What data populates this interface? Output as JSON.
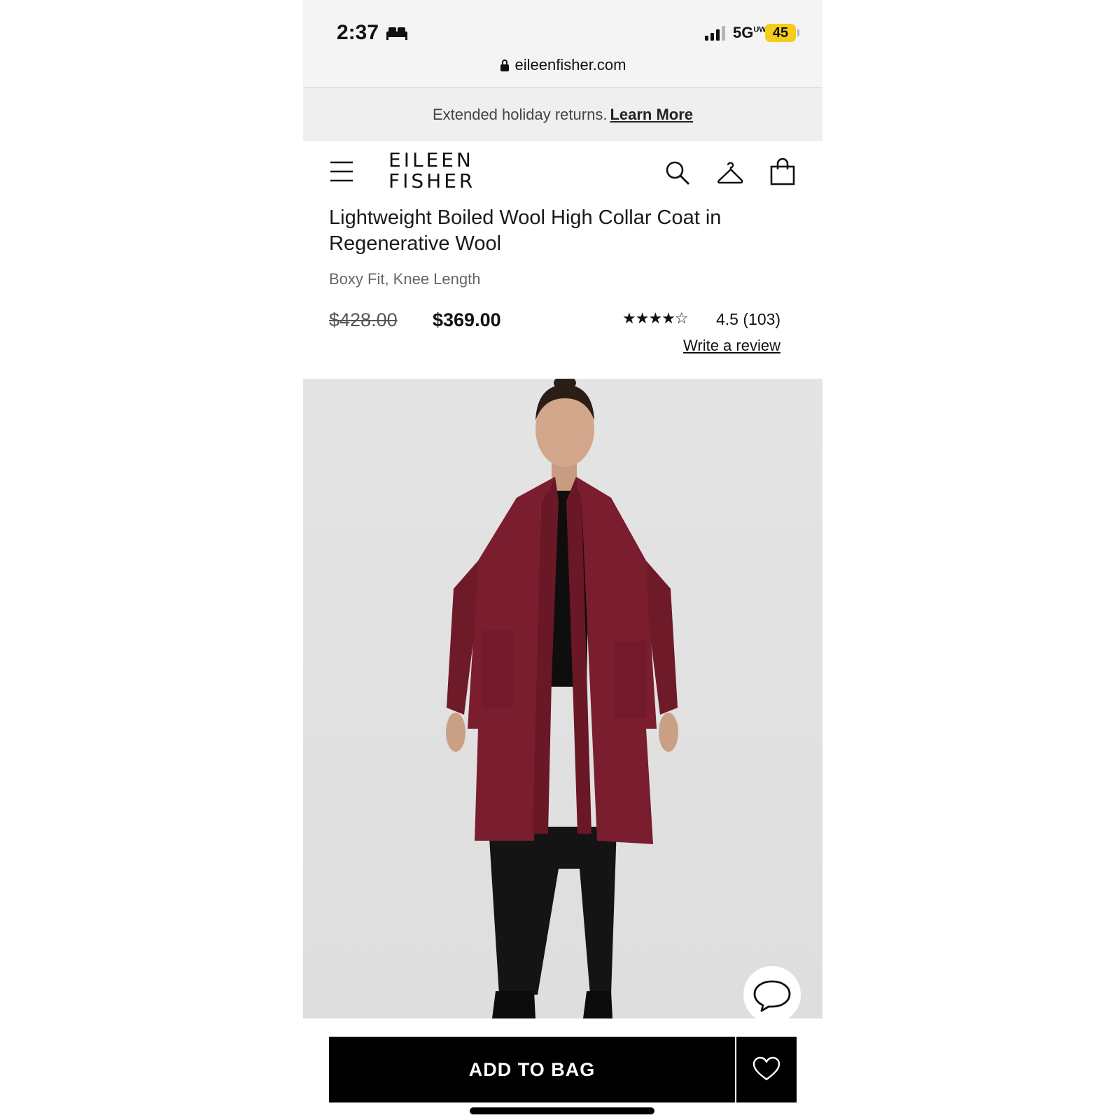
{
  "status_bar": {
    "time": "2:37",
    "network": "5G",
    "network_suffix": "UW",
    "battery": "45"
  },
  "browser": {
    "url": "eileenfisher.com"
  },
  "promo": {
    "text": "Extended holiday returns.",
    "link": "Learn More"
  },
  "header": {
    "logo_line1": "EILEEN",
    "logo_line2": "FISHER"
  },
  "product": {
    "title": "Lightweight Boiled Wool High Collar Coat in Regenerative Wool",
    "subtitle": "Boxy Fit, Knee Length",
    "original_price": "$428.00",
    "sale_price": "$369.00",
    "stars": "★★★★☆",
    "rating_value": 4.5,
    "rating": "4.5",
    "review_count": "(103)",
    "write_review": "Write a review",
    "coat_color": "#7a1d2e"
  },
  "actions": {
    "add_to_bag": "ADD TO BAG"
  },
  "colors": {
    "battery": "#f5cc1a",
    "button": "#000000",
    "promo_bg": "#efefef"
  }
}
